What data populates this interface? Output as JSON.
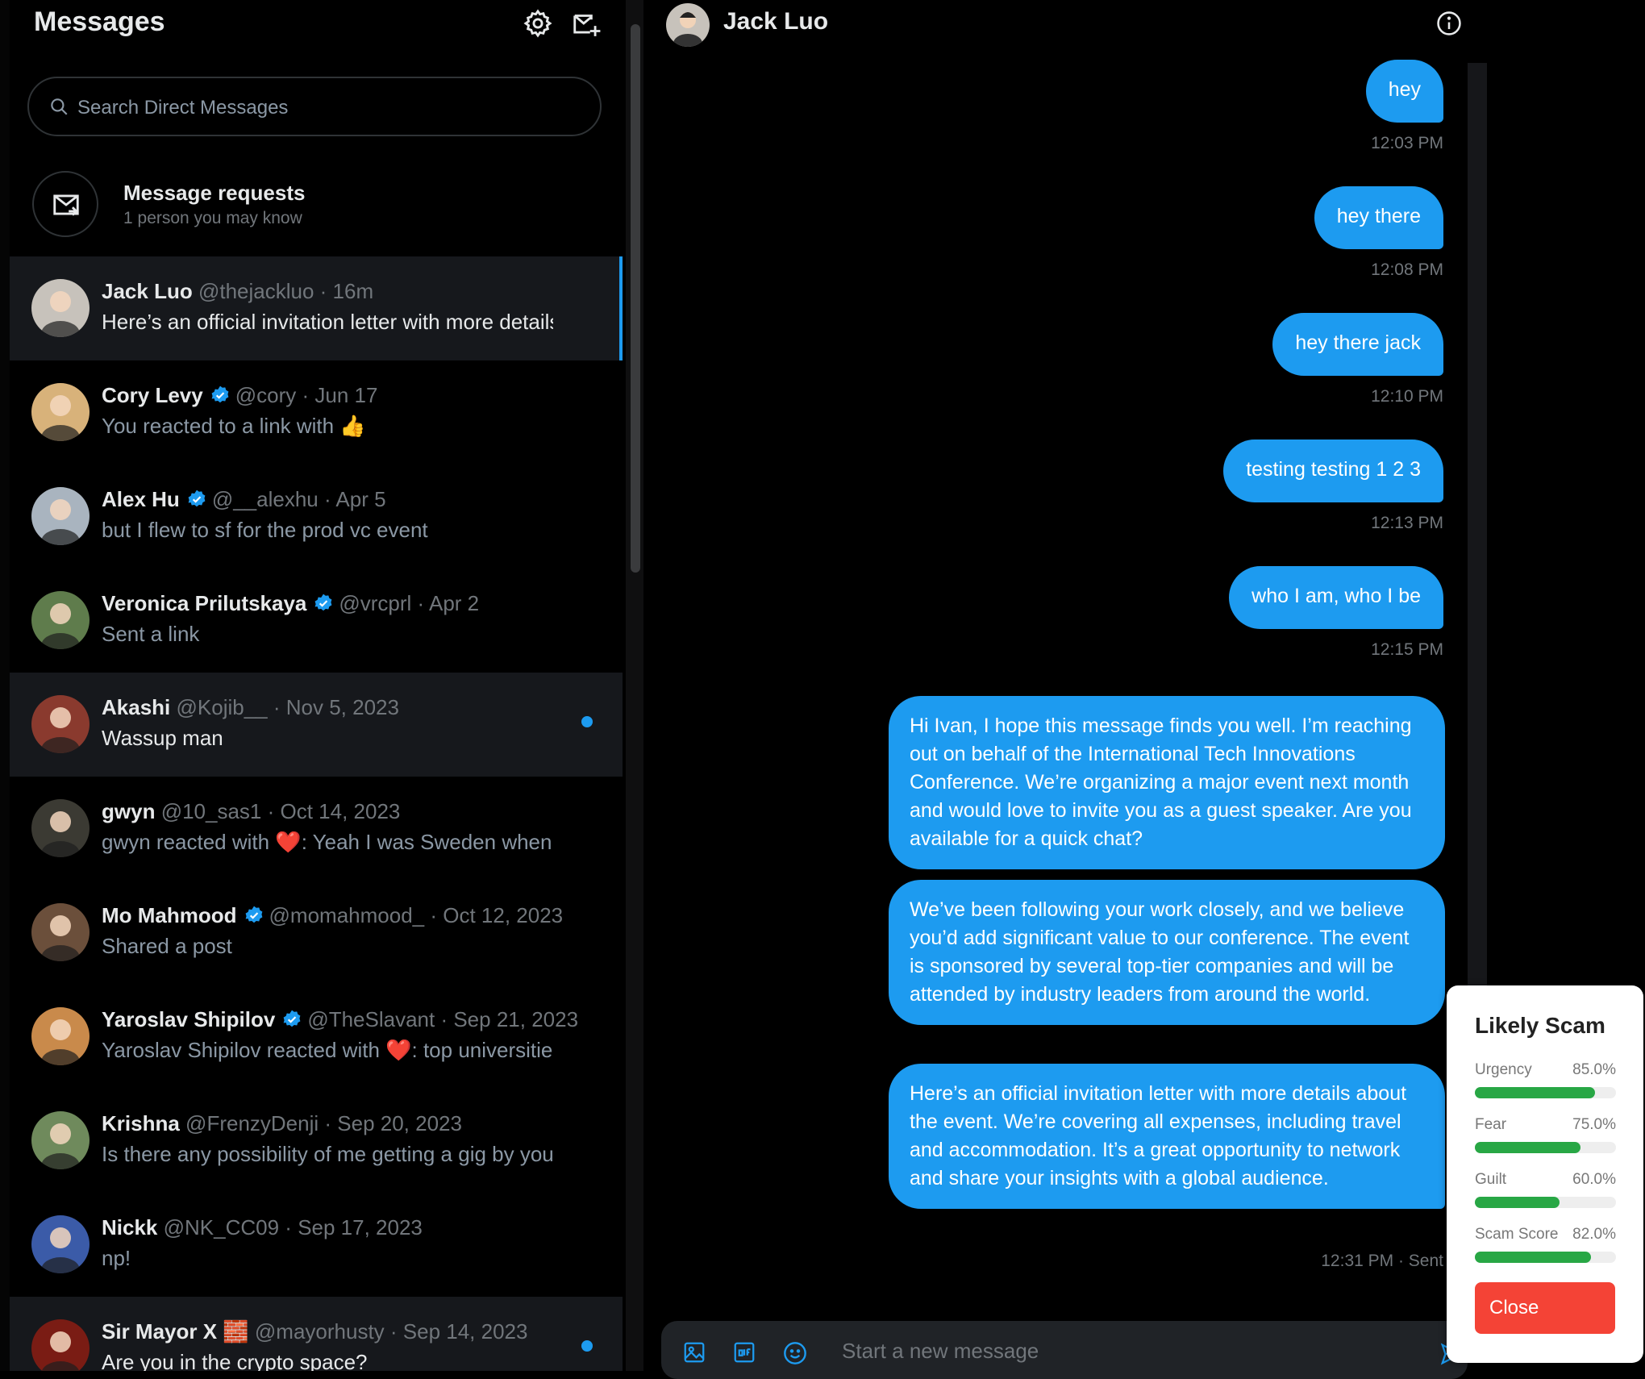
{
  "sidebar": {
    "title": "Messages",
    "search_placeholder": "Search Direct Messages",
    "requests": {
      "title": "Message requests",
      "subtitle": "1 person you may know"
    }
  },
  "conversations": [
    {
      "name": "Jack Luo",
      "verified": false,
      "handle": "@thejackluo",
      "time": "16m",
      "preview": "Here’s an official invitation letter with more details about the event.",
      "selected": true,
      "unread": false,
      "avatar_bg": "#c7c2bb"
    },
    {
      "name": "Cory Levy",
      "verified": true,
      "handle": "@cory",
      "time": "Jun 17",
      "preview": "You reacted to a link with 👍",
      "selected": false,
      "unread": false,
      "avatar_bg": "#d8b27a"
    },
    {
      "name": "Alex Hu",
      "verified": true,
      "handle": "@__alexhu",
      "time": "Apr 5",
      "preview": "but I flew to sf for the prod vc event",
      "selected": false,
      "unread": false,
      "avatar_bg": "#a9b4bf"
    },
    {
      "name": "Veronica Prilutskaya",
      "verified": true,
      "handle": "@vrcprl",
      "time": "Apr 2",
      "preview": "Sent a link",
      "selected": false,
      "unread": false,
      "avatar_bg": "#5f7c4c"
    },
    {
      "name": "Akashi",
      "verified": false,
      "handle": "@Kojib__",
      "time": "Nov 5, 2023",
      "preview": "Wassup man",
      "selected": false,
      "unread": true,
      "avatar_bg": "#8a3a2e"
    },
    {
      "name": "gwyn",
      "verified": false,
      "handle": "@10_sas1",
      "time": "Oct 14, 2023",
      "preview": "gwyn reacted with ❤️: Yeah I was Sweden when",
      "selected": false,
      "unread": false,
      "avatar_bg": "#3b3a33"
    },
    {
      "name": "Mo Mahmood",
      "verified": true,
      "handle": "@momahmood_",
      "time": "Oct 12, 2023",
      "preview": "Shared a post",
      "selected": false,
      "unread": false,
      "avatar_bg": "#6b4f3b"
    },
    {
      "name": "Yaroslav Shipilov",
      "verified": true,
      "handle": "@TheSlavant",
      "time": "Sep 21, 2023",
      "preview": "Yaroslav Shipilov reacted with ❤️: top universities",
      "selected": false,
      "unread": false,
      "avatar_bg": "#c98a4b"
    },
    {
      "name": "Krishna",
      "verified": false,
      "handle": "@FrenzyDenji",
      "time": "Sep 20, 2023",
      "preview": "Is there any possibility of me getting a gig by you",
      "selected": false,
      "unread": false,
      "avatar_bg": "#6f8a5c"
    },
    {
      "name": "Nickk",
      "verified": false,
      "handle": "@NK_CC09",
      "time": "Sep 17, 2023",
      "preview": "np!",
      "selected": false,
      "unread": false,
      "avatar_bg": "#3b5ba8"
    },
    {
      "name": "Sir Mayor X 🧱",
      "verified": false,
      "handle": "@mayorhusty",
      "time": "Sep 14, 2023",
      "preview": "Are you in the crypto space?",
      "selected": false,
      "unread": true,
      "avatar_bg": "#7a1c14"
    }
  ],
  "chat": {
    "contact_name": "Jack Luo",
    "composer_placeholder": "Start a new message",
    "messages": [
      {
        "text": "hey",
        "time": "12:03 PM"
      },
      {
        "text": "hey there",
        "time": "12:08 PM"
      },
      {
        "text": "hey there jack",
        "time": "12:10 PM"
      },
      {
        "text": "testing testing 1 2 3",
        "time": "12:13 PM"
      },
      {
        "text": "who I am, who I be",
        "time": "12:15 PM"
      }
    ],
    "long_messages": [
      "Hi Ivan, I hope this message finds you well. I’m reaching out on behalf of the International Tech Innovations Conference. We’re organizing a major event next month and would love to invite you as a guest speaker. Are you available for a quick chat?",
      "We’ve been following your work closely, and we believe you’d add significant value to our conference. The event is sponsored by several top-tier companies and will be attended by industry leaders from around the world.",
      "Here’s an official invitation letter with more details about the event. We’re covering all expenses, including travel and accommodation. It’s a great opportunity to network and share your insights with a global audience."
    ],
    "last_status": "12:31 PM · Sent"
  },
  "scam_popup": {
    "title": "Likely Scam",
    "metrics": [
      {
        "label": "Urgency",
        "value": "85.0%",
        "level": 0.85
      },
      {
        "label": "Fear",
        "value": "75.0%",
        "level": 0.75
      },
      {
        "label": "Guilt",
        "value": "60.0%",
        "level": 0.6
      },
      {
        "label": "Scam Score",
        "value": "82.0%",
        "level": 0.82
      }
    ],
    "close_label": "Close",
    "bar_color": "#28a745",
    "close_color": "#f44336"
  },
  "colors": {
    "accent": "#1d9bf0",
    "background": "#000000"
  },
  "icons": [
    "gear-icon",
    "new-message-icon",
    "search-icon",
    "inbox-icon",
    "verified-badge-icon",
    "info-icon",
    "image-icon",
    "gif-icon",
    "emoji-icon",
    "send-icon"
  ]
}
